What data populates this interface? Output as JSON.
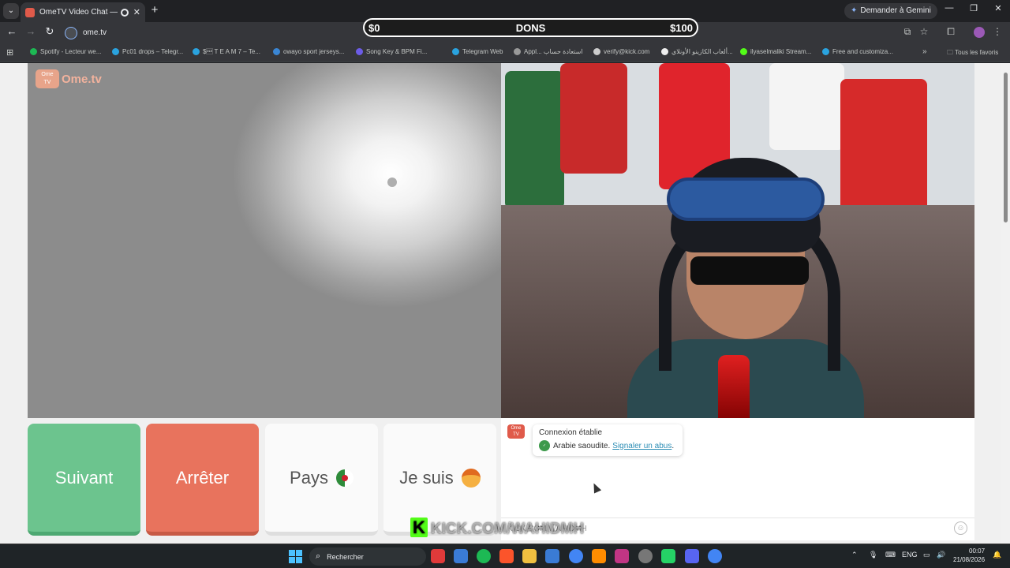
{
  "browser": {
    "tab_title": "OmeTV Video Chat — Ome",
    "url": "ome.tv",
    "gemini_label": "Demander à Gemini",
    "bookmarks": [
      {
        "label": "Spotify - Lecteur we...",
        "color": "#1db954"
      },
      {
        "label": "Pc01 drops – Telegr...",
        "color": "#2aa3df"
      },
      {
        "label": "$\u0010 T E A M 7 – Te...",
        "color": "#2aa3df"
      },
      {
        "label": "owayo sport jerseys...",
        "color": "#3a86d4"
      },
      {
        "label": "Song Key & BPM Fi...",
        "color": "#6c5ce7"
      },
      {
        "label": "Telegram Web",
        "color": "#2aa3df"
      },
      {
        "label": "Appl... استعادة حساب",
        "color": "#999999"
      },
      {
        "label": "verify@kick.com",
        "color": "#cccccc"
      },
      {
        "label": "ألعاب الكازينو الأونلاي...",
        "color": "#eeeeee"
      },
      {
        "label": "ilyaselmaliki Stream...",
        "color": "#53fc18"
      },
      {
        "label": "Free and customiza...",
        "color": "#2aa3df"
      }
    ],
    "all_bookmarks_label": "Tous les favoris"
  },
  "donations": {
    "left": "$0",
    "center": "DONS",
    "right": "$100"
  },
  "ometv": {
    "logo_top": "Ome",
    "logo_bottom": "TV",
    "logo_text": "Ome.tv",
    "buttons": {
      "next": "Suivant",
      "stop": "Arrêter",
      "country": "Pays",
      "iam": "Je suis"
    },
    "chat": {
      "avatar_top": "Ome",
      "avatar_bottom": "TV",
      "connection": "Connexion établie",
      "country": "Arabie saoudite.",
      "report_link": "Signaler un abus",
      "report_suffix": ".",
      "input_value": "KICK.COM/WAHIDMH"
    }
  },
  "overlay": {
    "kick_logo": "K",
    "kick_text": "KICK.COM/WAHIDMH"
  },
  "taskbar": {
    "search_label": "Rechercher",
    "lang": "ENG",
    "time": "00:07",
    "date": "21/08/2026",
    "apps": [
      "#e03a3a",
      "#3a7bd5",
      "#1db954",
      "#fb542b",
      "#f0c040",
      "#3a7bd5",
      "#4285f4",
      "#ff8c00",
      "#c13584",
      "#777777",
      "#25d366",
      "#5865f2",
      "#4285f4"
    ]
  },
  "colors": {
    "next_button": "#6cc48e",
    "stop_button": "#e8735d",
    "kick_green": "#53fc18",
    "link": "#2c8db5"
  }
}
